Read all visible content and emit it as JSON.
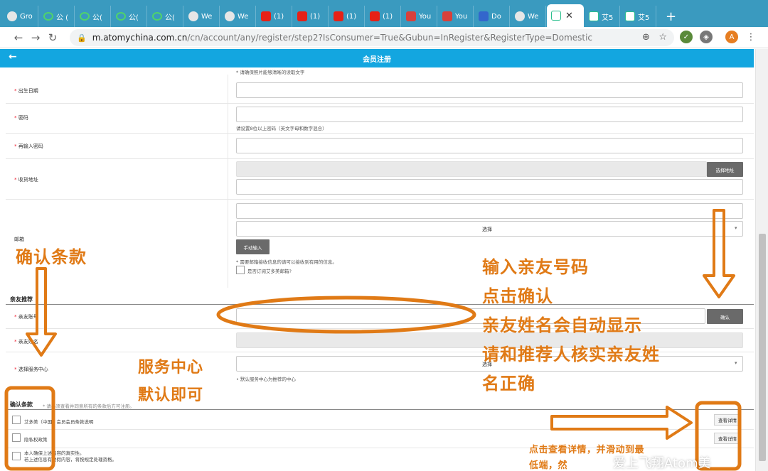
{
  "browser": {
    "tabs": [
      {
        "label": "Gro",
        "icon": "globe-icon",
        "fav": "globe"
      },
      {
        "label": "公 (",
        "icon": "wechat-icon",
        "fav": "green"
      },
      {
        "label": "公(",
        "icon": "wechat-icon",
        "fav": "green"
      },
      {
        "label": "公(",
        "icon": "wechat-icon",
        "fav": "green"
      },
      {
        "label": "公(",
        "icon": "wechat-icon",
        "fav": "green"
      },
      {
        "label": "We",
        "icon": "globe-icon",
        "fav": "globe"
      },
      {
        "label": "We",
        "icon": "globe-icon",
        "fav": "globe"
      },
      {
        "label": "(1)",
        "icon": "youtube-icon",
        "fav": "yt"
      },
      {
        "label": "(1)",
        "icon": "youtube-icon",
        "fav": "yt"
      },
      {
        "label": "(1)",
        "icon": "youtube-icon",
        "fav": "yt"
      },
      {
        "label": "(1)",
        "icon": "youtube-icon",
        "fav": "yt"
      },
      {
        "label": "You",
        "icon": "download-icon",
        "fav": "red"
      },
      {
        "label": "You",
        "icon": "download-icon",
        "fav": "red"
      },
      {
        "label": "Do",
        "icon": "download-icon",
        "fav": "dl"
      },
      {
        "label": "We",
        "icon": "globe-icon",
        "fav": "globe"
      }
    ],
    "active_tab": {
      "label": "",
      "icon": "site-icon"
    },
    "extra_tabs": [
      {
        "label": "艾5",
        "icon": "site-icon"
      },
      {
        "label": "艾5",
        "icon": "site-icon"
      }
    ],
    "new_tab_label": "+",
    "url_host": "m.atomychina.com.cn",
    "url_path": "/cn/account/any/register/step2?IsConsumer=True&Gubun=InRegister&RegisterType=Domestic",
    "profile_initial": "A",
    "minimize": "—",
    "maximize": "☐",
    "close": "✕"
  },
  "page": {
    "header_title": "会员注册",
    "back_label": "←"
  },
  "form": {
    "top_hint": "* 请确保照片能够清晰的读取文字",
    "birth_label": "出生日期",
    "password_label": "密码",
    "password_hint": "请设置8位以上密码（英文字母和数字混合）",
    "password_confirm_label": "再输入密码",
    "address_label": "收货地址",
    "address_button": "选择地址",
    "email_label": "邮箱",
    "email_select": "选择",
    "email_manual_button": "手动输入",
    "email_hint": "* 需要邮箱接收信息的请可以接收到有用的信息。",
    "email_sub_label": "是否订阅艾多美邮箱?",
    "referrer_section": "亲友推荐",
    "referrer_number_label": "亲友账号",
    "referrer_confirm_button": "确认",
    "referrer_name_label": "亲友姓名",
    "center_label": "选择服务中心",
    "center_select": "选择",
    "center_hint": "• 默认服务中心为推荐的中心",
    "terms_section": "确认条款",
    "terms_note": "* 请必须查看并同意所有的条款后方可注册。",
    "terms": [
      {
        "label": "艾多美（中国）会员会员条款说明",
        "button": "查看详情"
      },
      {
        "label": "隐私权政策",
        "button": "查看详情"
      },
      {
        "label": "本人确保上述内容的真实性。\n若上述信息有虚假内容，将按规定处理资格。",
        "button": ""
      }
    ]
  },
  "annotations": {
    "confirm_terms": "确认条款",
    "enter_number_line1": "输入亲友号码",
    "enter_number_line2": "点击确认",
    "enter_number_line3": "亲友姓名会自动显示",
    "enter_number_line4": "请和推荐人核实亲友姓",
    "enter_number_line5": "名正确",
    "service_line1": "服务中心",
    "service_line2": "默认即可",
    "view_details_line1": "点击查看详情，并滑动到最",
    "view_details_line2": "低端，然",
    "watermark": "爱上飞翔Atom美",
    "color": "#e07a16"
  }
}
